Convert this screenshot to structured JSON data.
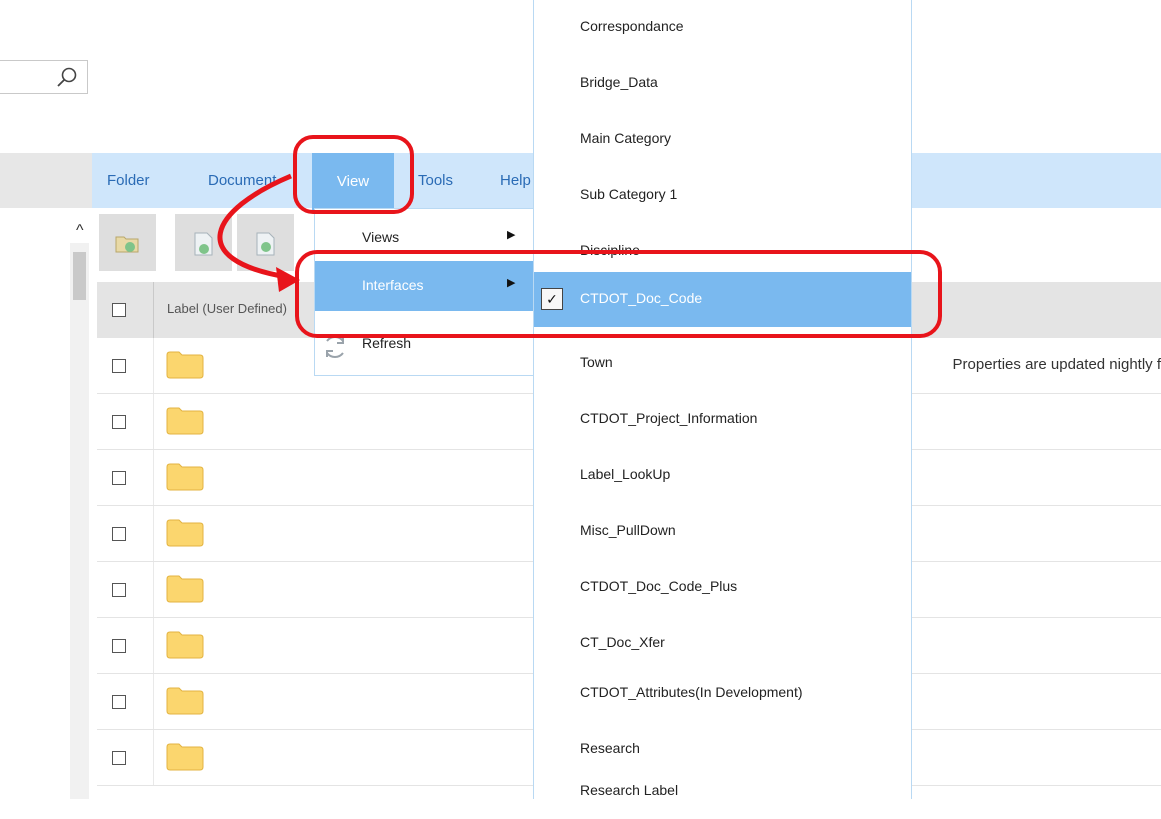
{
  "search": {
    "value": "",
    "placeholder": "",
    "icon": "search-icon"
  },
  "menubar": {
    "items": [
      {
        "label": "Folder"
      },
      {
        "label": "Document"
      },
      {
        "label": "View"
      },
      {
        "label": "Tools"
      },
      {
        "label": "Help"
      }
    ],
    "accent_color": "#7ab9ef",
    "bar_color": "#cfe6fb"
  },
  "view_menu": {
    "items": [
      {
        "label": "Views",
        "has_submenu": true
      },
      {
        "label": "Interfaces",
        "has_submenu": true
      },
      {
        "label": "Refresh",
        "icon": "refresh-icon"
      }
    ]
  },
  "interfaces_submenu": {
    "items": [
      {
        "label": "Correspondance"
      },
      {
        "label": "Bridge_Data"
      },
      {
        "label": "Main Category"
      },
      {
        "label": "Sub Category 1"
      },
      {
        "label": "Discipline"
      },
      {
        "label": "CTDOT_Doc_Code",
        "checked": true
      },
      {
        "label": "Town"
      },
      {
        "label": "CTDOT_Project_Information"
      },
      {
        "label": "Label_LookUp"
      },
      {
        "label": "Misc_PullDown"
      },
      {
        "label": "CTDOT_Doc_Code_Plus"
      },
      {
        "label": "CT_Doc_Xfer"
      },
      {
        "label": "CTDOT_Attributes(In Development)"
      },
      {
        "label": "Research"
      },
      {
        "label": "Research Label"
      }
    ],
    "check_mark": "✓"
  },
  "grid": {
    "columns": [
      {
        "label": "Label (User Defined)"
      }
    ],
    "row_description": "Properties are updated nightly f",
    "row_count": 8
  },
  "annotation_color": "#e8141b"
}
